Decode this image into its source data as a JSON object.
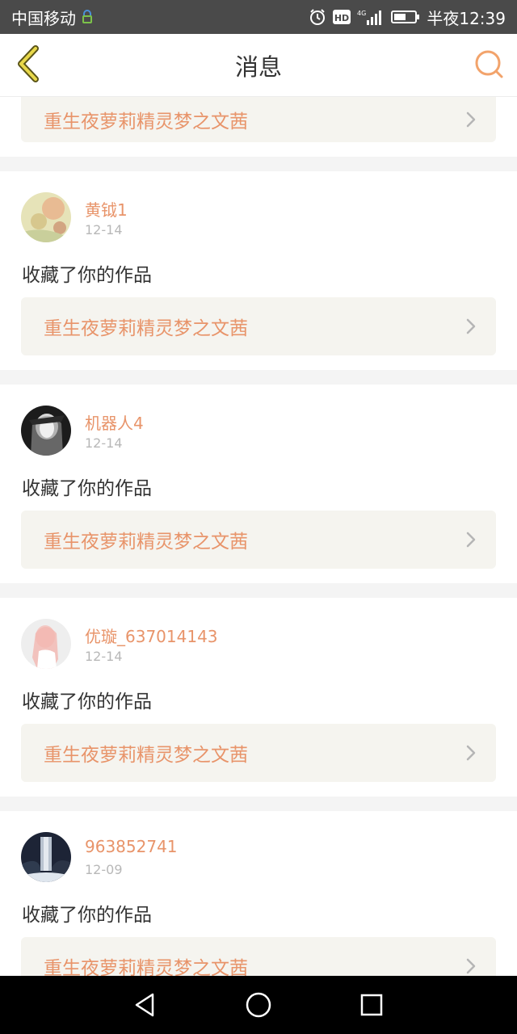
{
  "status_bar": {
    "carrier": "中国移动",
    "time": "半夜12:39",
    "hd_label": "HD",
    "network_label": "4G"
  },
  "header": {
    "title": "消息",
    "back_icon": "chevron-left-icon",
    "search_icon": "search-icon",
    "accent_color": "#e8946a"
  },
  "partial_item": {
    "work_title": "重生夜萝莉精灵梦之文茜"
  },
  "messages": [
    {
      "user": "黄钺1",
      "date": "12-14",
      "action": "收藏了你的作品",
      "work_title": "重生夜萝莉精灵梦之文茜"
    },
    {
      "user": "机器人4",
      "date": "12-14",
      "action": "收藏了你的作品",
      "work_title": "重生夜萝莉精灵梦之文茜"
    },
    {
      "user": "优璇_637014143",
      "date": "12-14",
      "action": "收藏了你的作品",
      "work_title": "重生夜萝莉精灵梦之文茜"
    },
    {
      "user": "963852741",
      "date": "12-09",
      "action": "收藏了你的作品",
      "work_title": "重生夜萝莉精灵梦之文茜"
    }
  ],
  "nav_bar": {
    "back_icon": "triangle-back-icon",
    "home_icon": "circle-home-icon",
    "recents_icon": "square-recents-icon"
  }
}
